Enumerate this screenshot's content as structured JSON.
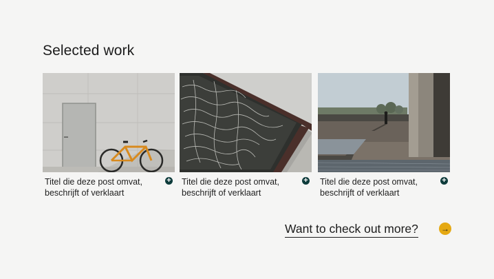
{
  "page": {
    "heading": "Selected work"
  },
  "cards": [
    {
      "caption": "Titel die deze post omvat, beschrijft of verklaart",
      "image": "concrete-wall-bicycle",
      "icon": "plus-icon"
    },
    {
      "caption": "Titel die deze post omvat, beschrijft of verklaart",
      "image": "water-pool-corner",
      "icon": "plus-icon"
    },
    {
      "caption": "Titel die deze post omvat, beschrijft of verklaart",
      "image": "plaza-pool-walker",
      "icon": "plus-icon"
    }
  ],
  "more": {
    "label": "Want to check out more?",
    "icon": "arrow-right-icon",
    "arrow_glyph": "→",
    "plus_glyph": "+"
  },
  "colors": {
    "background": "#f5f5f4",
    "accent": "#e5a913",
    "plus_badge": "#0d3b3b"
  }
}
